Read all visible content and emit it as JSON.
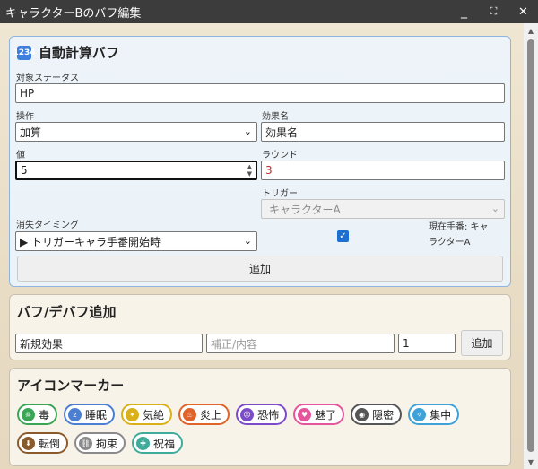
{
  "window": {
    "title": "キャラクターBのバフ編集",
    "minimize": "_",
    "maximize": "⛶",
    "close": "✕"
  },
  "calc_panel": {
    "title": "自動計算バフ",
    "icon": "1234",
    "target_status_label": "対象ステータス",
    "target_status_value": "HP",
    "operation_label": "操作",
    "operation_value": "加算",
    "effect_name_label": "効果名",
    "effect_name_value": "効果名",
    "value_label": "値",
    "value_value": "5",
    "round_label": "ラウンド",
    "round_value": "3",
    "trigger_label": "トリガー",
    "trigger_value": "キャラクターA",
    "expire_label": "消失タイミング",
    "expire_value": "▶ トリガーキャラ手番開始時",
    "checkbox_checked": true,
    "current_turn_line1": "現在手番: キャ",
    "current_turn_line2": "ラクターA",
    "add_button": "追加"
  },
  "buff_panel": {
    "title": "バフ/デバフ追加",
    "name_value": "新規効果",
    "content_placeholder": "補正/内容",
    "rounds_value": "1",
    "add_button": "追加"
  },
  "icon_panel": {
    "title": "アイコンマーカー",
    "markers_row1": [
      {
        "name": "poison",
        "label": "毒",
        "icon": "☠",
        "color": "#3aa655"
      },
      {
        "name": "sleep",
        "label": "睡眠",
        "icon": "z",
        "color": "#4a7fd4"
      },
      {
        "name": "stun",
        "label": "気絶",
        "icon": "✦",
        "color": "#d9b019"
      },
      {
        "name": "burn",
        "label": "炎上",
        "icon": "♨",
        "color": "#e0642a"
      },
      {
        "name": "fear",
        "label": "恐怖",
        "icon": "☹",
        "color": "#7c4bc9"
      },
      {
        "name": "charm",
        "label": "魅了",
        "icon": "♥",
        "color": "#e4559b"
      },
      {
        "name": "stealth",
        "label": "隠密",
        "icon": "◉",
        "color": "#555555"
      },
      {
        "name": "focus",
        "label": "集中",
        "icon": "✧",
        "color": "#3ea2d8"
      }
    ],
    "markers_row2": [
      {
        "name": "prone",
        "label": "転倒",
        "icon": "⬇",
        "color": "#8a5a2b"
      },
      {
        "name": "restrain",
        "label": "拘束",
        "icon": "⛓",
        "color": "#8a8a8a"
      },
      {
        "name": "blessing",
        "label": "祝福",
        "icon": "✚",
        "color": "#3eab9b"
      }
    ]
  }
}
